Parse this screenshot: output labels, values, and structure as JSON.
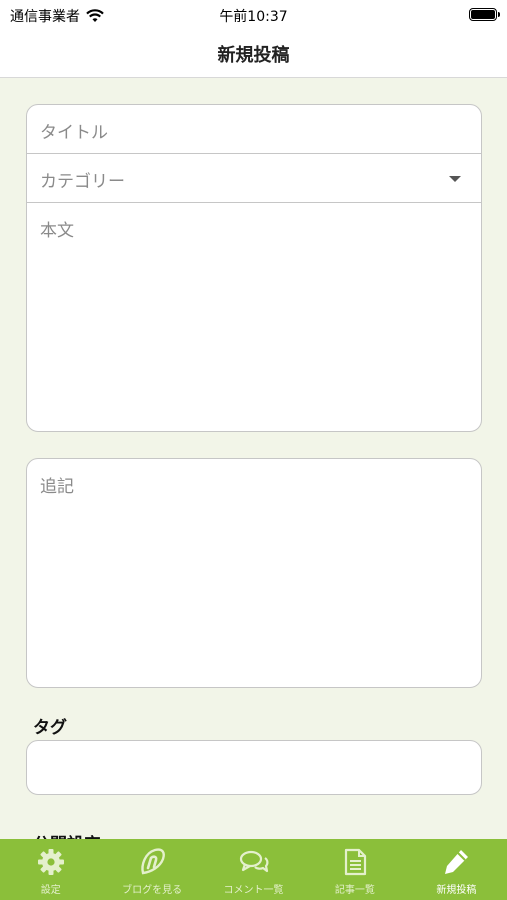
{
  "status_bar": {
    "carrier": "通信事業者",
    "time": "午前10:37"
  },
  "nav": {
    "title": "新規投稿"
  },
  "form": {
    "title_placeholder": "タイトル",
    "category_placeholder": "カテゴリー",
    "body_placeholder": "本文",
    "postscript_placeholder": "追記",
    "tag_label": "タグ",
    "publish_label": "公開設定"
  },
  "tab_bar": {
    "items": [
      {
        "label": "設定",
        "icon": "gear-icon"
      },
      {
        "label": "ブログを見る",
        "icon": "blog-icon"
      },
      {
        "label": "コメント一覧",
        "icon": "comments-icon"
      },
      {
        "label": "記事一覧",
        "icon": "document-icon"
      },
      {
        "label": "新規投稿",
        "icon": "pencil-icon"
      }
    ],
    "active_index": 4,
    "background": "#8bbf3a"
  }
}
